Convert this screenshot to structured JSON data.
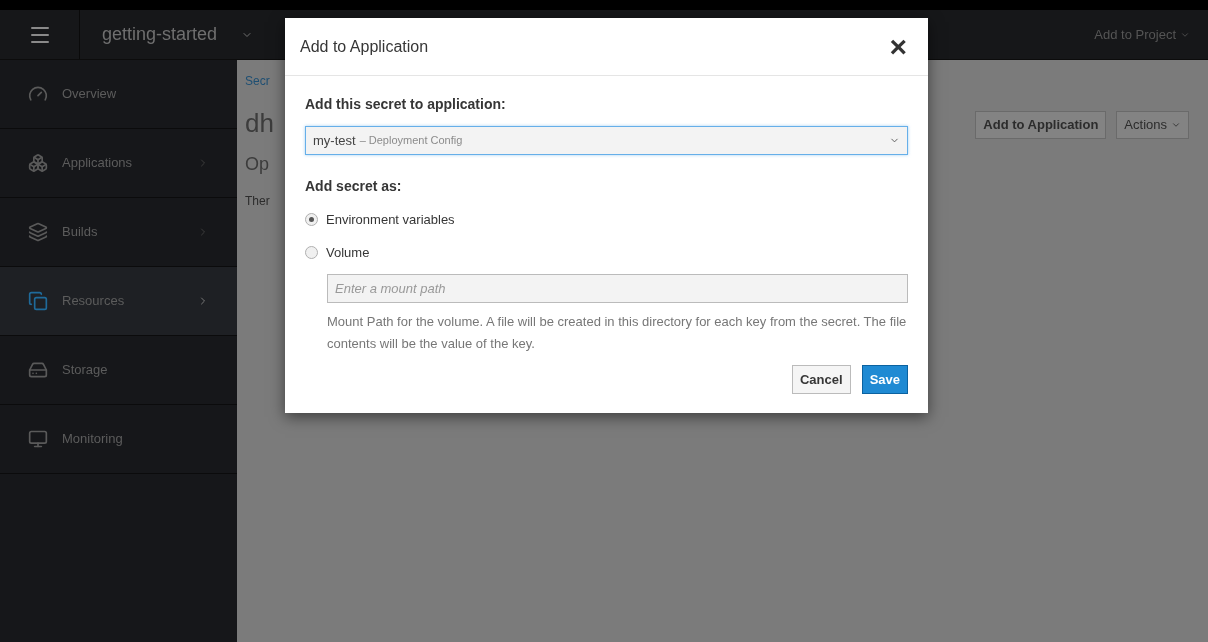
{
  "header": {
    "project": "getting-started",
    "add_to_project": "Add to Project"
  },
  "sidebar": {
    "items": [
      {
        "label": "Overview",
        "has_submenu": false,
        "selected": false
      },
      {
        "label": "Applications",
        "has_submenu": true,
        "selected": false
      },
      {
        "label": "Builds",
        "has_submenu": true,
        "selected": false
      },
      {
        "label": "Resources",
        "has_submenu": true,
        "selected": true
      },
      {
        "label": "Storage",
        "has_submenu": false,
        "selected": false
      },
      {
        "label": "Monitoring",
        "has_submenu": false,
        "selected": false
      }
    ]
  },
  "content": {
    "breadcrumb": "Secr",
    "title": "dh",
    "section": "Op",
    "text": "Ther",
    "buttons": [
      "Add to Application",
      "Actions"
    ]
  },
  "dialog": {
    "title": "Add to Application",
    "close": "×",
    "select_label": "Add this secret to application:",
    "select_value": "my-test",
    "select_kind": "– Deployment Config",
    "mode_label": "Add secret as:",
    "options": [
      {
        "label": "Environment variables",
        "selected": true
      },
      {
        "label": "Volume",
        "selected": false
      }
    ],
    "mount_placeholder": "Enter a mount path",
    "help": "Mount Path for the volume. A file will be created in this directory for each key from the secret. The file contents will be the value of the key.",
    "buttons": [
      {
        "label": "Cancel",
        "kind": "default"
      },
      {
        "label": "Save",
        "kind": "primary"
      }
    ]
  }
}
